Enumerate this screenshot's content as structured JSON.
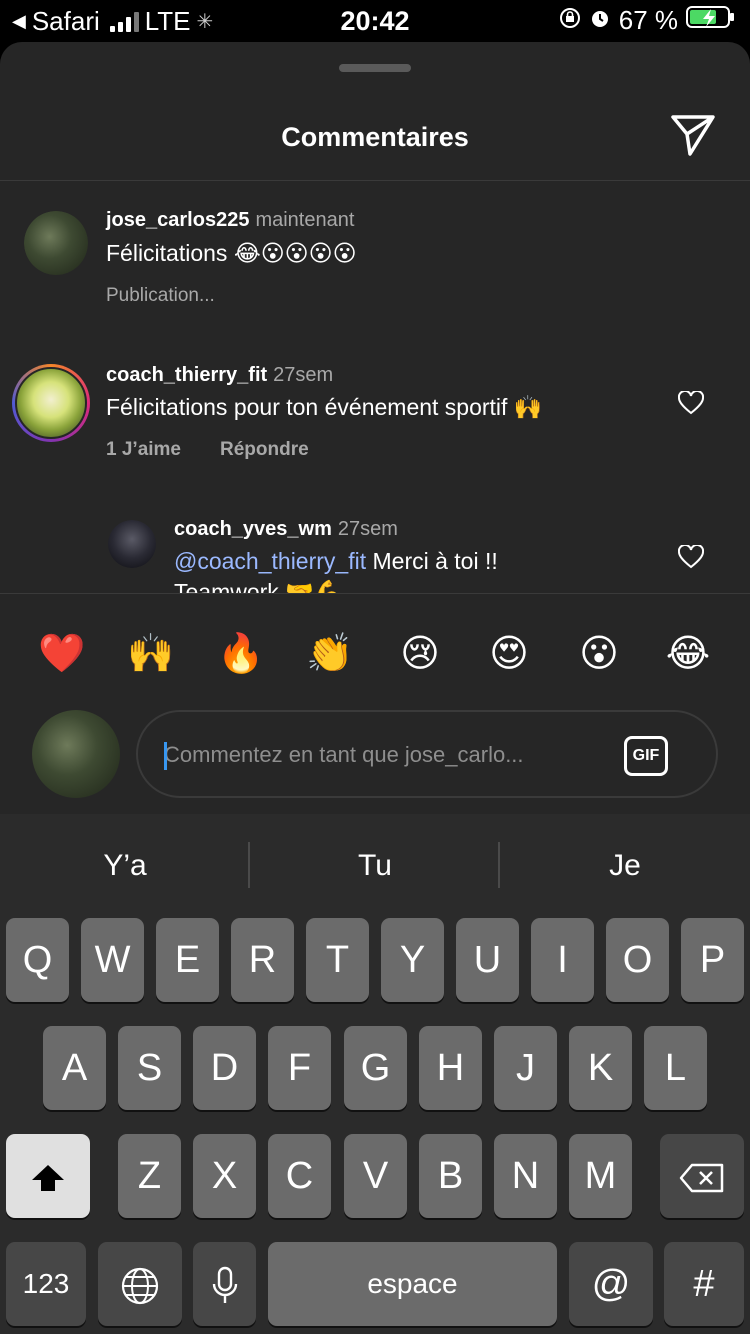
{
  "status_bar": {
    "back_app": "Safari",
    "network": "LTE",
    "time": "20:42",
    "battery_percent": "67 %"
  },
  "sheet": {
    "title": "Commentaires",
    "send_icon": "paper-plane-icon"
  },
  "comments": [
    {
      "username": "jose_carlos225",
      "time": "maintenant",
      "text": "Félicitations 😂😮😮😮😮",
      "status": "Publication..."
    },
    {
      "username": "coach_thierry_fit",
      "time": "27sem",
      "text": "Félicitations pour ton événement sportif 🙌",
      "likes": "1 J’aime",
      "reply_label": "Répondre"
    }
  ],
  "reply": {
    "username": "coach_yves_wm",
    "time": "27sem",
    "mention": "@coach_thierry_fit",
    "text_line1": " Merci à toi !!",
    "text_line2": "Teamwork 🤝💪"
  },
  "quick_reactions": [
    "❤️",
    "🙌",
    "🔥",
    "👏",
    "😢",
    "😍",
    "😮",
    "😂"
  ],
  "input": {
    "placeholder": "Commentez en tant que jose_carlo...",
    "gif_label": "GIF"
  },
  "keyboard": {
    "predictions": [
      "Y’a",
      "Tu",
      "Je"
    ],
    "row1": [
      "Q",
      "W",
      "E",
      "R",
      "T",
      "Y",
      "U",
      "I",
      "O",
      "P"
    ],
    "row2": [
      "A",
      "S",
      "D",
      "F",
      "G",
      "H",
      "J",
      "K",
      "L"
    ],
    "row3": [
      "Z",
      "X",
      "C",
      "V",
      "B",
      "N",
      "M"
    ],
    "numbers_label": "123",
    "space_label": "espace",
    "at_label": "@",
    "hash_label": "#"
  },
  "colors": {
    "sheet_background": "#262626",
    "mention": "#9bb9ff",
    "secondary_text": "#a8a8a8",
    "caret": "#3897f0"
  }
}
